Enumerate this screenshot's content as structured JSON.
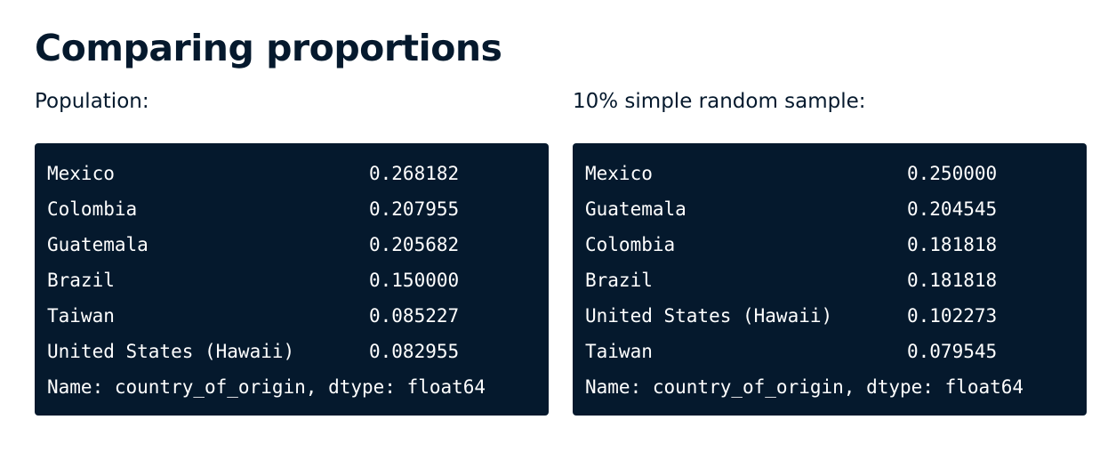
{
  "title": "Comparing proportions",
  "population": {
    "label": "Population:",
    "rows": [
      {
        "country": "Mexico",
        "value": "0.268182"
      },
      {
        "country": "Colombia",
        "value": "0.207955"
      },
      {
        "country": "Guatemala",
        "value": "0.205682"
      },
      {
        "country": "Brazil",
        "value": "0.150000"
      },
      {
        "country": "Taiwan",
        "value": "0.085227"
      },
      {
        "country": "United States (Hawaii)",
        "value": "0.082955"
      }
    ],
    "footer": "Name: country_of_origin, dtype: float64"
  },
  "sample": {
    "label": "10% simple random sample:",
    "rows": [
      {
        "country": "Mexico",
        "value": "0.250000"
      },
      {
        "country": "Guatemala",
        "value": "0.204545"
      },
      {
        "country": "Colombia",
        "value": "0.181818"
      },
      {
        "country": "Brazil",
        "value": "0.181818"
      },
      {
        "country": "United States (Hawaii)",
        "value": "0.102273"
      },
      {
        "country": "Taiwan",
        "value": "0.079545"
      }
    ],
    "footer": "Name: country_of_origin, dtype: float64"
  },
  "colors": {
    "text": "#05192d",
    "code_background": "#05192d",
    "code_text": "#ffffff"
  }
}
